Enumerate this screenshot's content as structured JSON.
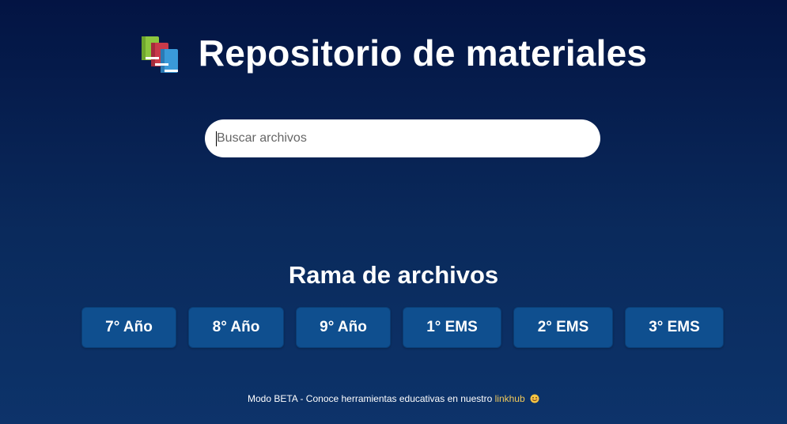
{
  "header": {
    "icon": "books-icon",
    "title": "Repositorio de materiales"
  },
  "search": {
    "placeholder": "Buscar archivos",
    "value": ""
  },
  "branches": {
    "title": "Rama de archivos",
    "items": [
      {
        "label": "7° Año"
      },
      {
        "label": "8° Año"
      },
      {
        "label": "9° Año"
      },
      {
        "label": "1° EMS"
      },
      {
        "label": "2° EMS"
      },
      {
        "label": "3° EMS"
      }
    ]
  },
  "footer": {
    "text": "Modo BETA - Conoce herramientas educativas en nuestro ",
    "link_label": "linkhub",
    "emoji": "smiling-face-icon"
  },
  "colors": {
    "background_top": "#031443",
    "background_bottom": "#0d336a",
    "button": "#0f4f8f",
    "link": "#f0c95b"
  }
}
